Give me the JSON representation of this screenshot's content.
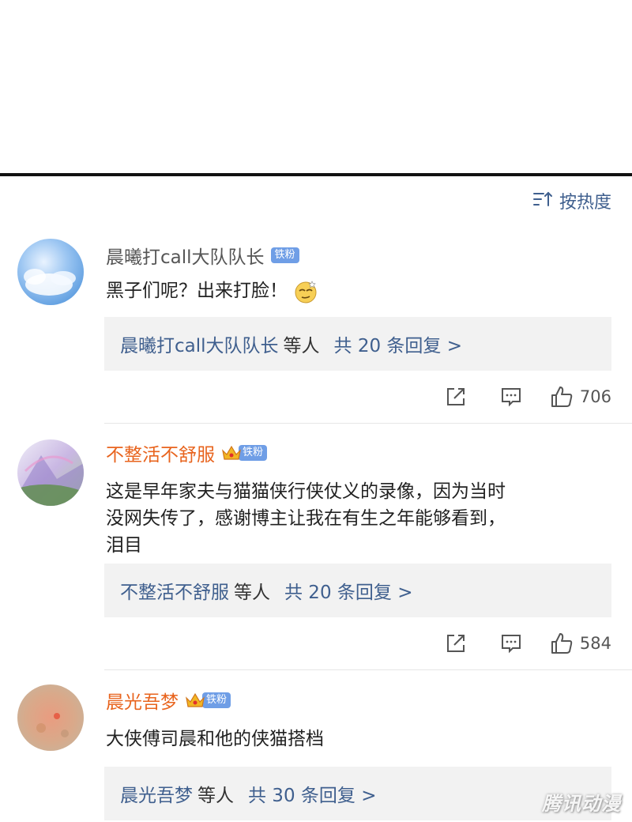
{
  "sort": {
    "label": "按热度",
    "icon": "sort-icon"
  },
  "comments": [
    {
      "username": "晨曦打call大队队长",
      "badge": "铁粉",
      "text": "黑子们呢？出来打脸！",
      "emoji": "smug-emoji",
      "replies": {
        "who": "晨曦打call大队队长",
        "etc": "等人",
        "count": "共 20 条回复 >"
      },
      "likes": "706"
    },
    {
      "username": "不整活不舒服",
      "badge": "铁粉",
      "text_lines": [
        "这是早年家夫与猫猫侠行侠仗义的录像，因为当时",
        "没网失传了，感谢博主让我在有生之年能够看到，",
        "泪目"
      ],
      "replies": {
        "who": "不整活不舒服",
        "etc": "等人",
        "count": "共 20 条回复 >"
      },
      "likes": "584"
    },
    {
      "username": "晨光吾梦",
      "badge": "铁粉",
      "text": "大侠傅司晨和他的侠猫搭档",
      "replies": {
        "who": "晨光吾梦",
        "etc": "等人",
        "count": "共 30 条回复 >"
      }
    }
  ],
  "watermark": "腾讯动漫",
  "colors": {
    "link": "#3f5f8e",
    "vip_name": "#e8641e",
    "badge": "#6f9ee6",
    "reply_bg": "#f2f2f2"
  }
}
